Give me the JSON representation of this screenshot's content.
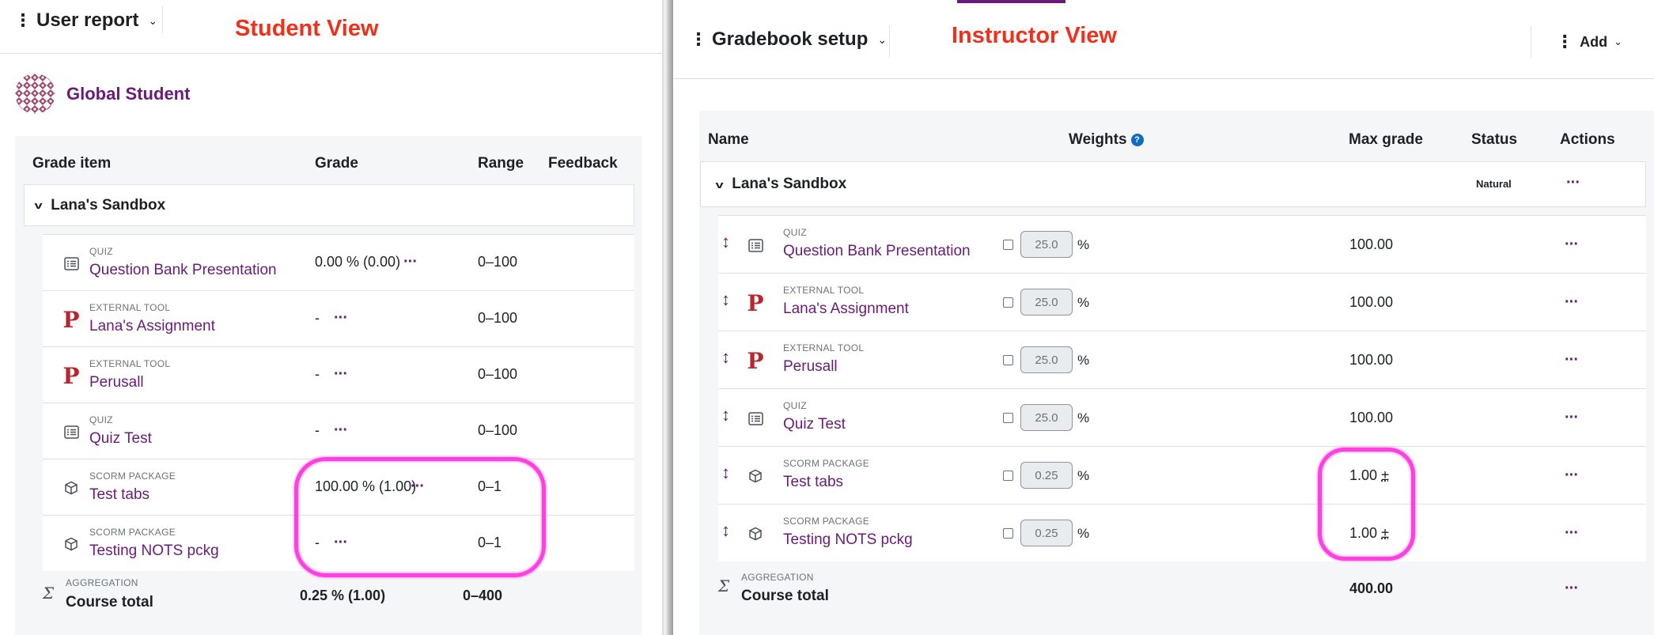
{
  "student_view": {
    "header_title": "User report",
    "view_label": "Student View",
    "student_name": "Global Student",
    "columns": {
      "item": "Grade item",
      "grade": "Grade",
      "range": "Range",
      "feedback": "Feedback"
    },
    "category": "Lana's Sandbox",
    "items": [
      {
        "type": "QUIZ",
        "name": "Question Bank Presentation",
        "grade": "0.00 % (0.00)",
        "range": "0–100",
        "icon": "quiz-icon"
      },
      {
        "type": "EXTERNAL TOOL",
        "name": "Lana's Assignment",
        "grade": "-",
        "range": "0–100",
        "icon": "perusall-p-icon"
      },
      {
        "type": "EXTERNAL TOOL",
        "name": "Perusall",
        "grade": "-",
        "range": "0–100",
        "icon": "perusall-p-icon"
      },
      {
        "type": "QUIZ",
        "name": "Quiz Test",
        "grade": "-",
        "range": "0–100",
        "icon": "quiz-icon"
      },
      {
        "type": "SCORM PACKAGE",
        "name": "Test tabs",
        "grade": "100.00 % (1.00)",
        "range": "0–1",
        "icon": "scorm-package-icon"
      },
      {
        "type": "SCORM PACKAGE",
        "name": "Testing NOTS pckg",
        "grade": "-",
        "range": "0–1",
        "icon": "scorm-package-icon"
      }
    ],
    "total": {
      "type": "AGGREGATION",
      "name": "Course total",
      "grade": "0.25 % (1.00)",
      "range": "0–400"
    }
  },
  "instructor_view": {
    "header_title": "Gradebook setup",
    "view_label": "Instructor View",
    "add_label": "Add",
    "columns": {
      "name": "Name",
      "weights": "Weights",
      "max_grade": "Max grade",
      "status": "Status",
      "actions": "Actions"
    },
    "help_glyph": "?",
    "category": {
      "name": "Lana's Sandbox",
      "status": "Natural"
    },
    "items": [
      {
        "type": "QUIZ",
        "name": "Question Bank Presentation",
        "weight": "25.0",
        "max": "100.00",
        "plusminus": "",
        "icon": "quiz-icon"
      },
      {
        "type": "EXTERNAL TOOL",
        "name": "Lana's Assignment",
        "weight": "25.0",
        "max": "100.00",
        "plusminus": "",
        "icon": "perusall-p-icon"
      },
      {
        "type": "EXTERNAL TOOL",
        "name": "Perusall",
        "weight": "25.0",
        "max": "100.00",
        "plusminus": "",
        "icon": "perusall-p-icon"
      },
      {
        "type": "QUIZ",
        "name": "Quiz Test",
        "weight": "25.0",
        "max": "100.00",
        "plusminus": "",
        "icon": "quiz-icon"
      },
      {
        "type": "SCORM PACKAGE",
        "name": "Test tabs",
        "weight": "0.25",
        "max": "1.00",
        "plusminus": "±",
        "icon": "scorm-package-icon"
      },
      {
        "type": "SCORM PACKAGE",
        "name": "Testing NOTS pckg",
        "weight": "0.25",
        "max": "1.00",
        "plusminus": "±",
        "icon": "scorm-package-icon"
      }
    ],
    "percent_sign": "%",
    "total": {
      "type": "AGGREGATION",
      "name": "Course total",
      "max": "400.00"
    }
  },
  "colors": {
    "accent": "#6a1b78",
    "view_label": "#f0301a",
    "highlight": "#ff3fe0",
    "perusall": "#b8262f"
  }
}
